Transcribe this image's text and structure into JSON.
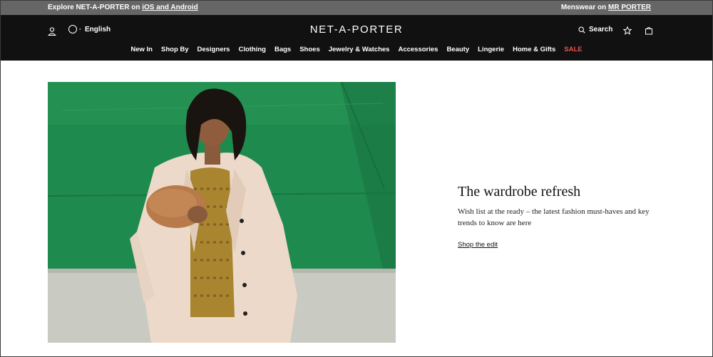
{
  "promo": {
    "left_prefix": "Explore NET-A-PORTER on",
    "left_link": "iOS and Android",
    "right_prefix": "Menswear on",
    "right_link": "MR PORTER"
  },
  "header": {
    "language": "English",
    "logo": "NET-A-PORTER",
    "search_label": "Search",
    "icons": {
      "account": "user-icon",
      "language": "globe-icon",
      "search": "search-icon",
      "wishlist": "star-icon",
      "bag": "shopping-bag-icon"
    }
  },
  "nav": {
    "items": [
      "New In",
      "Shop By",
      "Designers",
      "Clothing",
      "Bags",
      "Shoes",
      "Jewelry & Watches",
      "Accessories",
      "Beauty",
      "Lingerie",
      "Home & Gifts"
    ],
    "sale": "SALE",
    "sale_color": "#e8554c"
  },
  "hero": {
    "title": "The wardrobe refresh",
    "subtitle": "Wish list at the ready – the latest fashion must-haves and key trends to know are here",
    "link": "Shop the edit"
  },
  "colors": {
    "promo_bg": "#666666",
    "header_bg": "#111111",
    "hero_green": "#1f8a4d"
  }
}
